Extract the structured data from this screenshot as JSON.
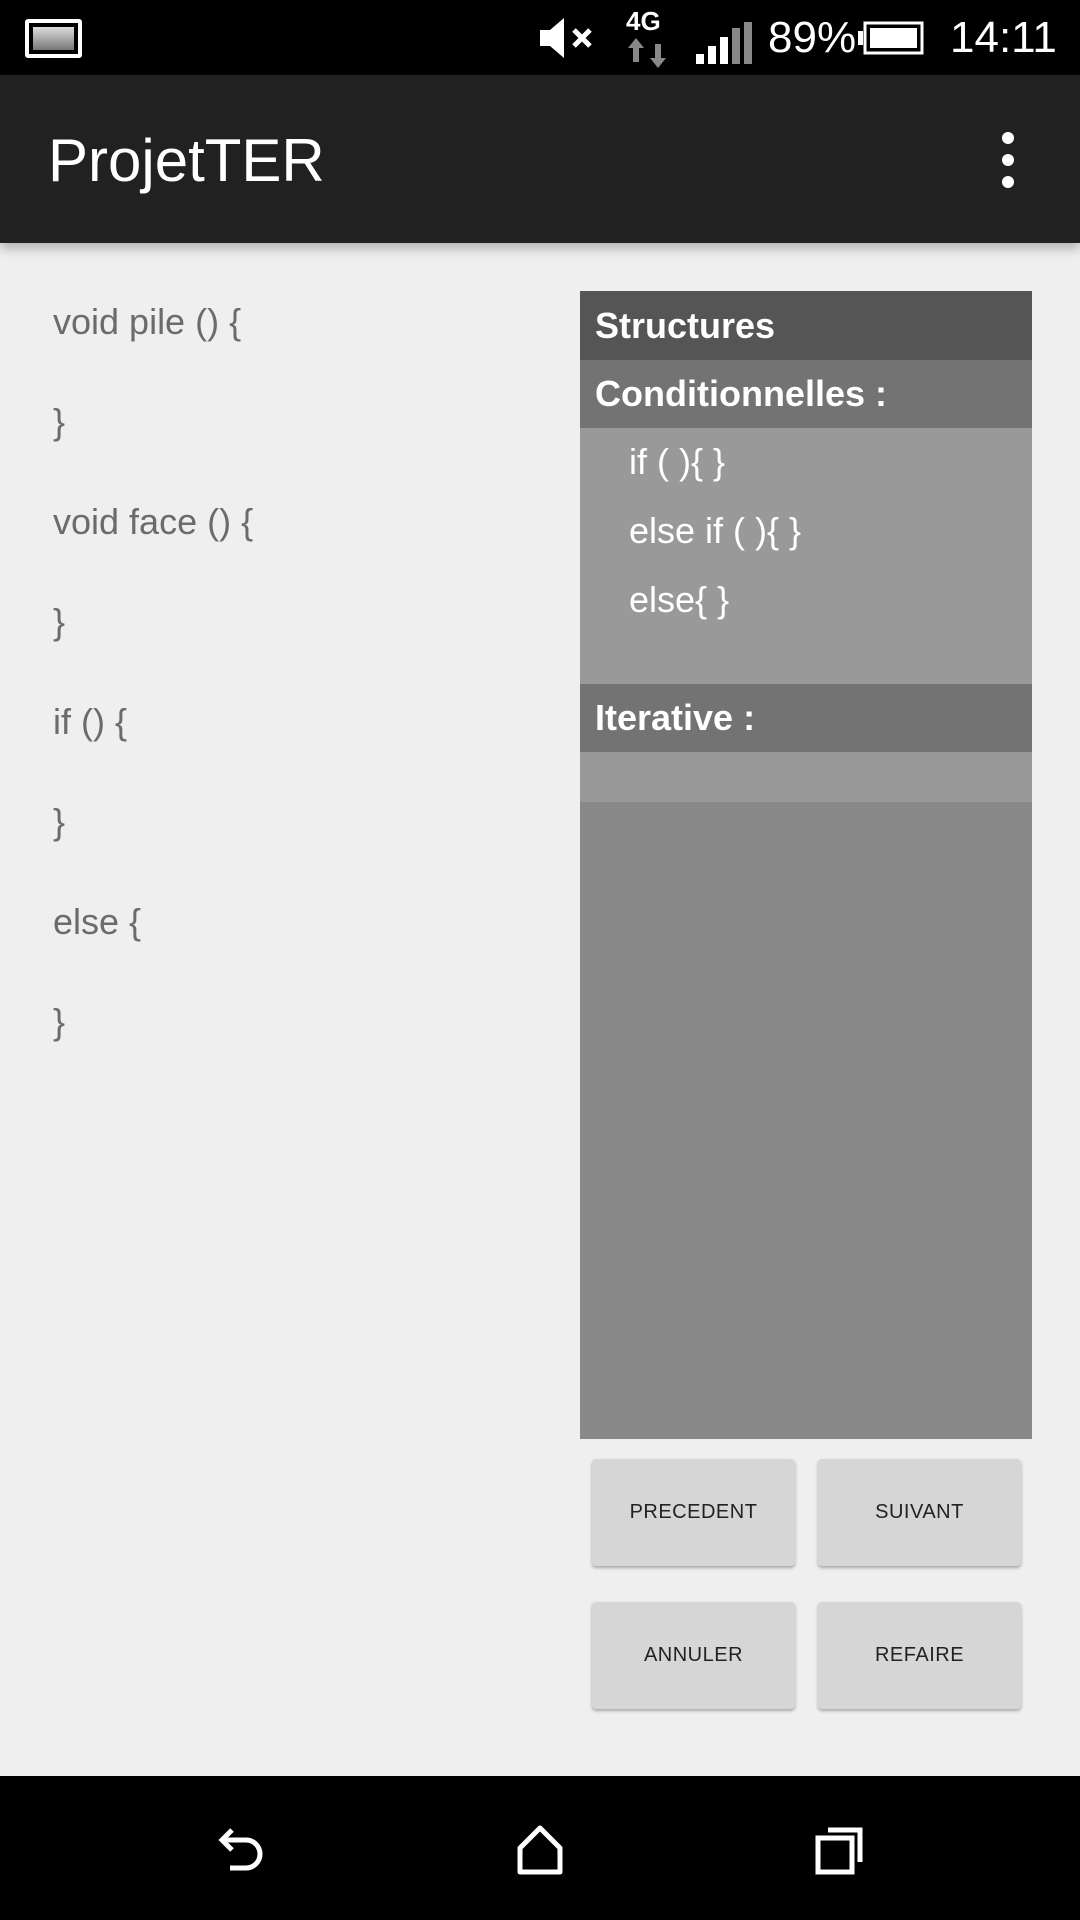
{
  "status_bar": {
    "battery_percent": "89%",
    "time": "14:11",
    "network": "4G",
    "icons": [
      "image-icon",
      "mute-icon",
      "4g-icon",
      "signal-icon",
      "battery-icon"
    ]
  },
  "app_bar": {
    "title": "ProjetTER",
    "overflow_icon": "more-vert-icon"
  },
  "code_lines": [
    "void pile () {",
    "}",
    "void face () {",
    "}",
    "if () {",
    "}",
    "else {",
    "}"
  ],
  "panel": {
    "title": "Structures",
    "conditional_header": "Conditionnelles :",
    "conditional_items": [
      "if ( ){ }",
      "else if ( ){ }",
      "else{ }"
    ],
    "iterative_header": "Iterative :"
  },
  "buttons": {
    "previous": "PRECEDENT",
    "next": "SUIVANT",
    "cancel": "ANNULER",
    "redo": "REFAIRE"
  },
  "nav_bar": {
    "icons": [
      "back-icon",
      "home-icon",
      "recents-icon"
    ]
  },
  "colors": {
    "app_bar": "#212121",
    "background": "#efefef",
    "panel": "#888888",
    "panel_header": "#555555",
    "section_header": "#737373",
    "list_bg": "#999999",
    "button": "#d6d6d6"
  }
}
